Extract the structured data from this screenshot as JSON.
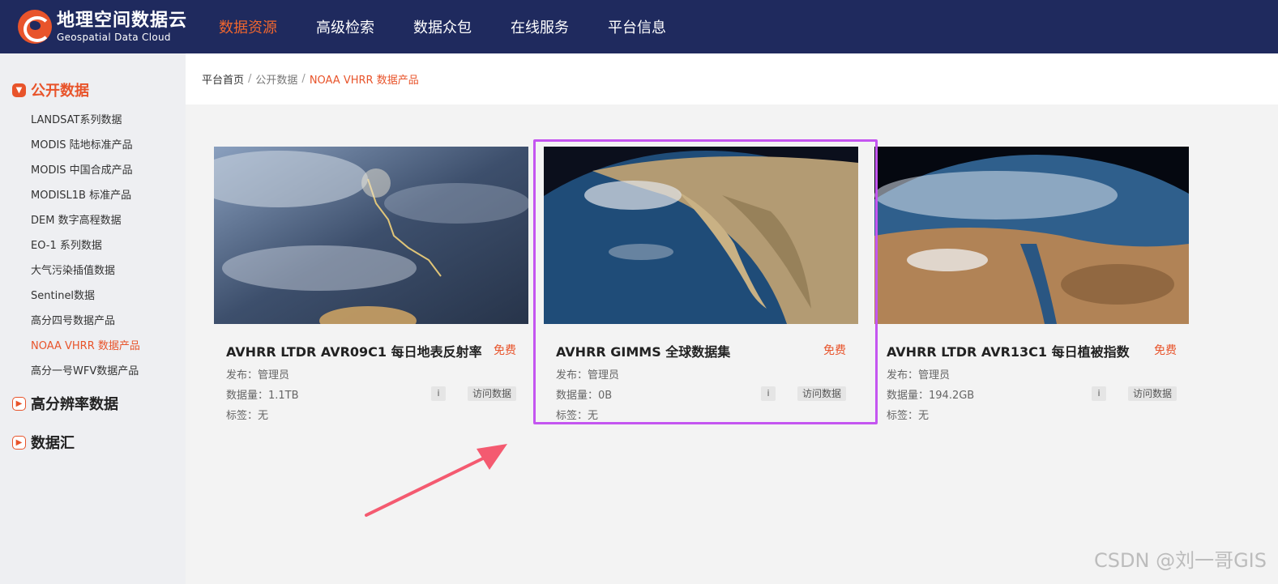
{
  "header": {
    "logo_cn": "地理空间数据云",
    "logo_en": "Geospatial Data Cloud",
    "nav": [
      "数据资源",
      "高级检索",
      "数据众包",
      "在线服务",
      "平台信息"
    ],
    "active_nav": "数据资源",
    "bg_color": "#1f2a5e",
    "accent_color": "#e8542b"
  },
  "sidebar": {
    "groups": [
      {
        "title": "公开数据",
        "icon": "chevron-down-icon",
        "items": [
          "LANDSAT系列数据",
          "MODIS 陆地标准产品",
          "MODIS 中国合成产品",
          "MODISL1B 标准产品",
          "DEM 数字高程数据",
          "EO-1 系列数据",
          "大气污染插值数据",
          "Sentinel数据",
          "高分四号数据产品",
          "NOAA VHRR 数据产品",
          "高分一号WFV数据产品"
        ],
        "active_item": "NOAA VHRR 数据产品"
      },
      {
        "title": "高分辨率数据",
        "icon": "chevron-right-icon"
      },
      {
        "title": "数据汇",
        "icon": "chevron-right-icon"
      }
    ]
  },
  "breadcrumb": [
    "平台首页",
    "公开数据",
    "NOAA VHRR 数据产品"
  ],
  "cards": [
    {
      "title": "AVHRR LTDR AVR09C1 每日地表反射率",
      "price": "免费",
      "publisher": "发布：管理员",
      "volume": "数据量：1.1TB",
      "tags": "标签：无",
      "info": "i",
      "visit": "访问数据"
    },
    {
      "title": "AVHRR GIMMS 全球数据集",
      "price": "免费",
      "publisher": "发布：管理员",
      "volume": "数据量：0B",
      "tags": "标签：无",
      "info": "i",
      "visit": "访问数据"
    },
    {
      "title": "AVHRR LTDR AVR13C1 每日植被指数",
      "price": "免费",
      "publisher": "发布：管理员",
      "volume": "数据量：194.2GB",
      "tags": "标签：无",
      "info": "i",
      "visit": "访问数据"
    }
  ],
  "watermark": "CSDN @刘一哥GIS"
}
